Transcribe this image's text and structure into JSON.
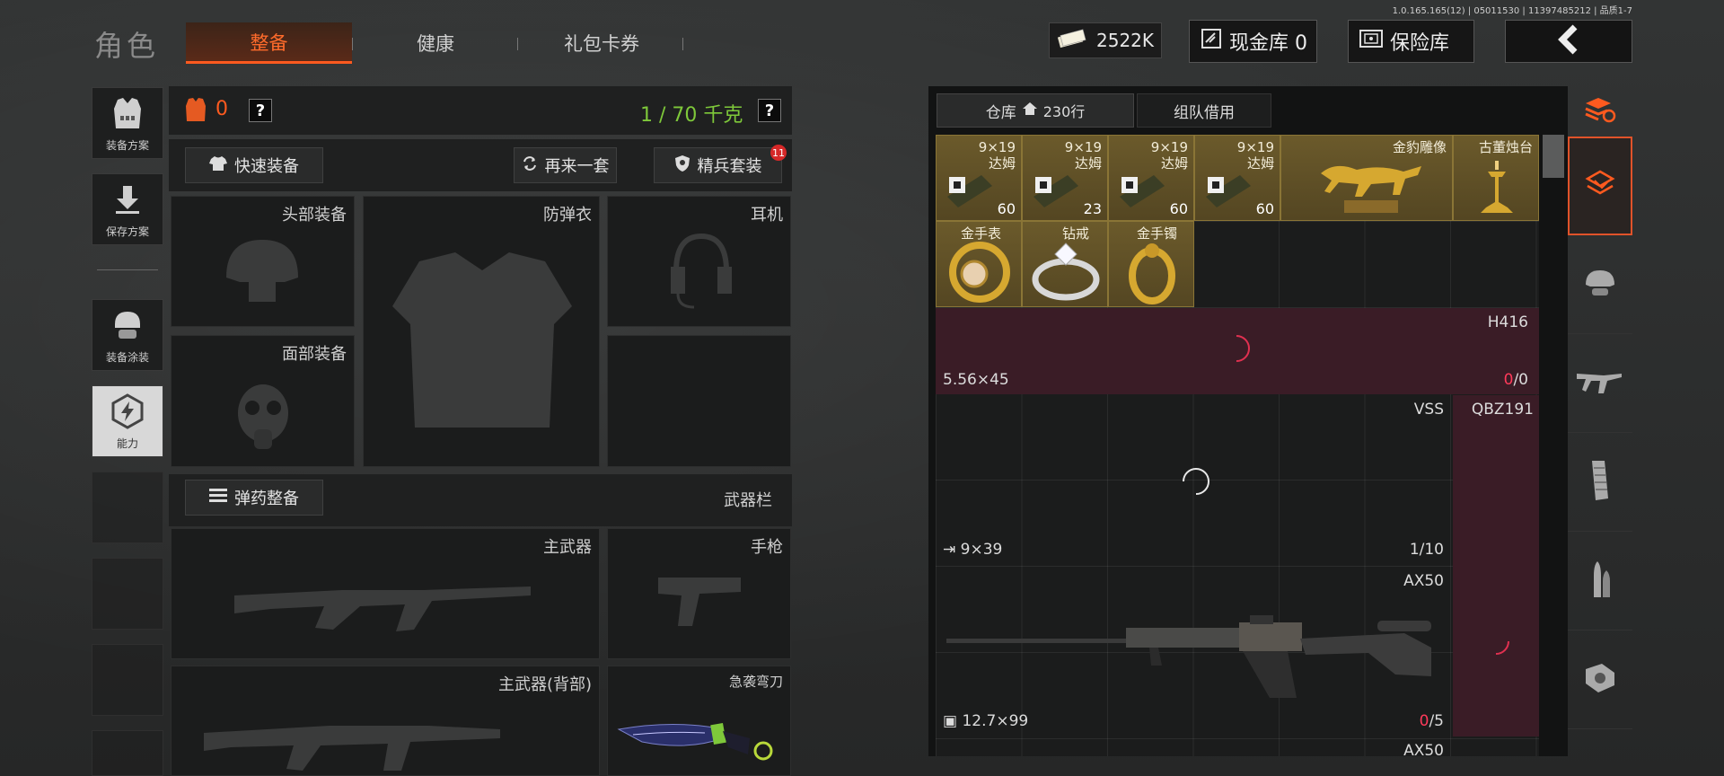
{
  "version": "1.0.165.165(12) | 05011530 | 11397485212 | 品质1-7",
  "header": {
    "title": "角色",
    "tabs": [
      {
        "label": "整备",
        "active": true
      },
      {
        "label": "健康",
        "active": false
      },
      {
        "label": "礼包卡券",
        "active": false
      }
    ],
    "money": "2522K",
    "cash_vault": "现金库 0",
    "safe": "保险库"
  },
  "sidenav": [
    {
      "label": "装备方案",
      "icon": "vest-icon"
    },
    {
      "label": "保存方案",
      "icon": "download-icon"
    },
    {
      "label": "装备涂装",
      "icon": "helmet-icon"
    },
    {
      "label": "能力",
      "icon": "ability-icon",
      "active": true
    }
  ],
  "equipment": {
    "armor_count": "0",
    "weight": "1 / 70 千克",
    "quick_equip": "快速装备",
    "again_set": "再来一套",
    "elite_set": "精兵套装",
    "elite_badge": "11",
    "slots": {
      "head": "头部装备",
      "vest": "防弹衣",
      "headset": "耳机",
      "face": "面部装备",
      "primary": "主武器",
      "pistol": "手枪",
      "primary_back": "主武器(背部)",
      "melee": "急袭弯刀"
    },
    "ammo_btn": "弹药整备",
    "weapon_bar": "武器栏"
  },
  "warehouse": {
    "tab_storage": "仓库",
    "rows": "230行",
    "tab_team": "组队借用",
    "ammo_items": [
      {
        "name1": "9×19",
        "name2": "达姆",
        "count": "60"
      },
      {
        "name1": "9×19",
        "name2": "达姆",
        "count": "23"
      },
      {
        "name1": "9×19",
        "name2": "达姆",
        "count": "60"
      },
      {
        "name1": "9×19",
        "name2": "达姆",
        "count": "60"
      }
    ],
    "gold_items": [
      {
        "name": "金豹雕像"
      },
      {
        "name": "古董烛台"
      },
      {
        "name": "金手表"
      },
      {
        "name": "钻戒"
      },
      {
        "name": "金手镯"
      }
    ],
    "weapons": [
      {
        "name": "H416",
        "caliber": "5.56×45",
        "ammo_cur": "0",
        "ammo_max": "0"
      },
      {
        "name": "VSS",
        "caliber": "9×39",
        "ammo": "1/10"
      },
      {
        "name": "QBZ191"
      },
      {
        "name": "AX50",
        "caliber": "12.7×99",
        "ammo_cur": "0",
        "ammo_max": "5"
      },
      {
        "name": "AX50"
      }
    ]
  },
  "colors": {
    "accent": "#ff5a1f",
    "weight_green": "#7ec83a",
    "gold": "#6b5a2b",
    "pink_row": "#3a1c26"
  }
}
